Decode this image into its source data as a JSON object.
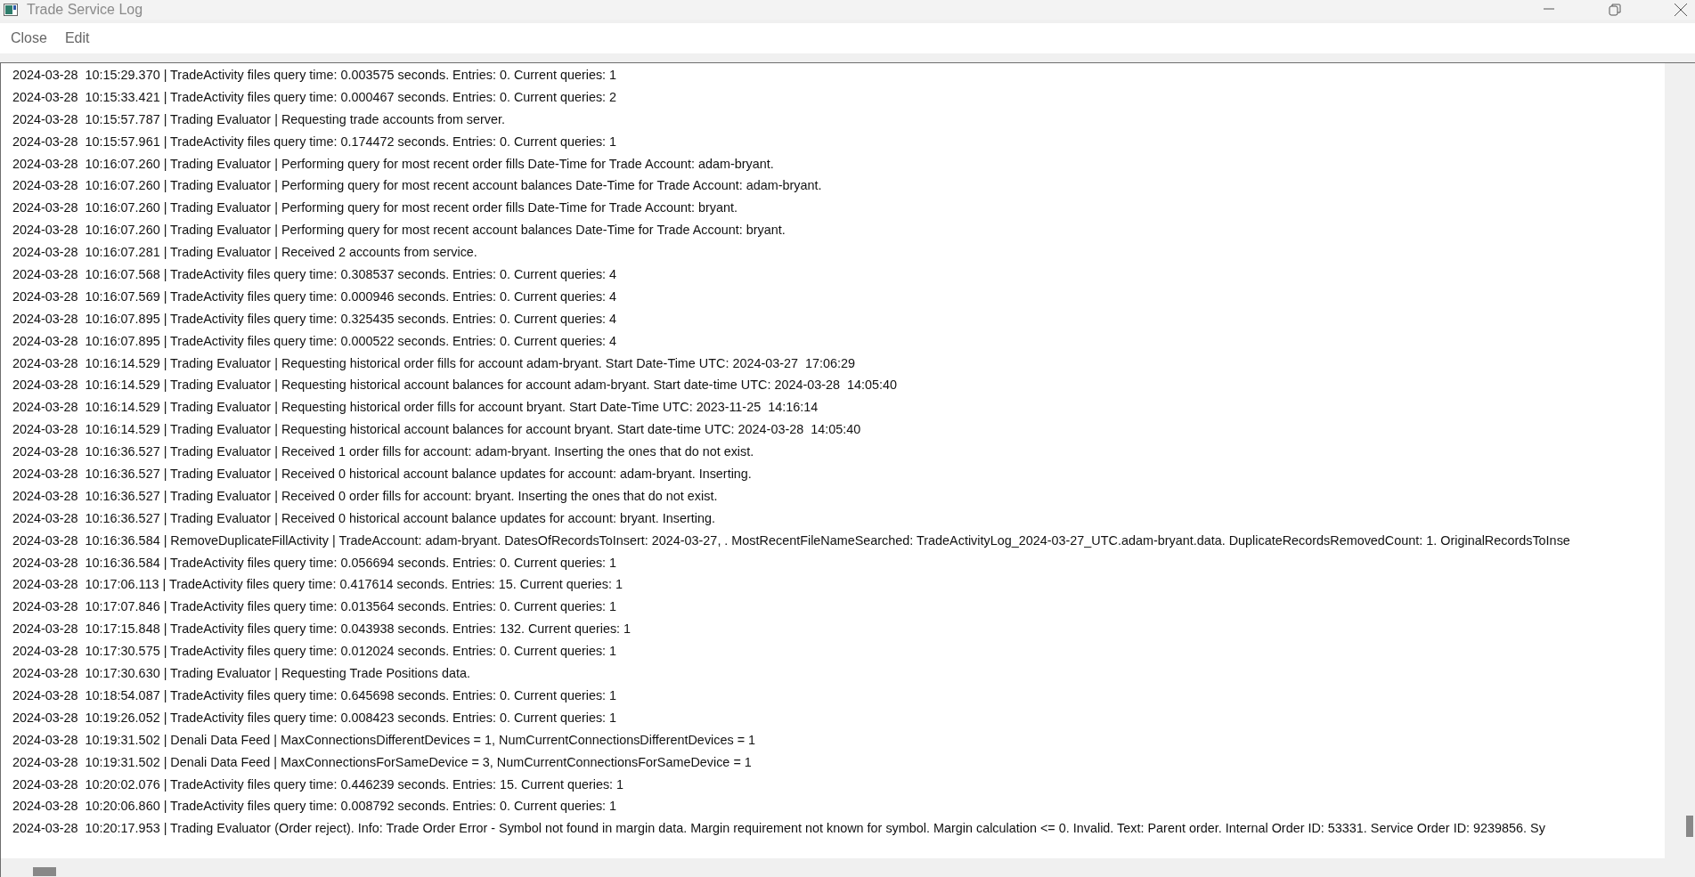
{
  "window": {
    "title": "Trade Service Log"
  },
  "menu": [
    "Close",
    "Edit"
  ],
  "log_lines": [
    "2024-03-28  10:15:29.370 | TradeActivity files query time: 0.003575 seconds. Entries: 0. Current queries: 1",
    "2024-03-28  10:15:33.421 | TradeActivity files query time: 0.000467 seconds. Entries: 0. Current queries: 2",
    "2024-03-28  10:15:57.787 | Trading Evaluator | Requesting trade accounts from server.",
    "2024-03-28  10:15:57.961 | TradeActivity files query time: 0.174472 seconds. Entries: 0. Current queries: 1",
    "2024-03-28  10:16:07.260 | Trading Evaluator | Performing query for most recent order fills Date-Time for Trade Account: adam-bryant.",
    "2024-03-28  10:16:07.260 | Trading Evaluator | Performing query for most recent account balances Date-Time for Trade Account: adam-bryant.",
    "2024-03-28  10:16:07.260 | Trading Evaluator | Performing query for most recent order fills Date-Time for Trade Account: bryant.",
    "2024-03-28  10:16:07.260 | Trading Evaluator | Performing query for most recent account balances Date-Time for Trade Account: bryant.",
    "2024-03-28  10:16:07.281 | Trading Evaluator | Received 2 accounts from service.",
    "2024-03-28  10:16:07.568 | TradeActivity files query time: 0.308537 seconds. Entries: 0. Current queries: 4",
    "2024-03-28  10:16:07.569 | TradeActivity files query time: 0.000946 seconds. Entries: 0. Current queries: 4",
    "2024-03-28  10:16:07.895 | TradeActivity files query time: 0.325435 seconds. Entries: 0. Current queries: 4",
    "2024-03-28  10:16:07.895 | TradeActivity files query time: 0.000522 seconds. Entries: 0. Current queries: 4",
    "2024-03-28  10:16:14.529 | Trading Evaluator | Requesting historical order fills for account adam-bryant. Start Date-Time UTC: 2024-03-27  17:06:29",
    "2024-03-28  10:16:14.529 | Trading Evaluator | Requesting historical account balances for account adam-bryant. Start date-time UTC: 2024-03-28  14:05:40",
    "2024-03-28  10:16:14.529 | Trading Evaluator | Requesting historical order fills for account bryant. Start Date-Time UTC: 2023-11-25  14:16:14",
    "2024-03-28  10:16:14.529 | Trading Evaluator | Requesting historical account balances for account bryant. Start date-time UTC: 2024-03-28  14:05:40",
    "2024-03-28  10:16:36.527 | Trading Evaluator | Received 1 order fills for account: adam-bryant. Inserting the ones that do not exist.",
    "2024-03-28  10:16:36.527 | Trading Evaluator | Received 0 historical account balance updates for account: adam-bryant. Inserting.",
    "2024-03-28  10:16:36.527 | Trading Evaluator | Received 0 order fills for account: bryant. Inserting the ones that do not exist.",
    "2024-03-28  10:16:36.527 | Trading Evaluator | Received 0 historical account balance updates for account: bryant. Inserting.",
    "2024-03-28  10:16:36.584 | RemoveDuplicateFillActivity | TradeAccount: adam-bryant. DatesOfRecordsToInsert: 2024-03-27, . MostRecentFileNameSearched: TradeActivityLog_2024-03-27_UTC.adam-bryant.data. DuplicateRecordsRemovedCount: 1. OriginalRecordsToInse",
    "2024-03-28  10:16:36.584 | TradeActivity files query time: 0.056694 seconds. Entries: 0. Current queries: 1",
    "2024-03-28  10:17:06.113 | TradeActivity files query time: 0.417614 seconds. Entries: 15. Current queries: 1",
    "2024-03-28  10:17:07.846 | TradeActivity files query time: 0.013564 seconds. Entries: 0. Current queries: 1",
    "2024-03-28  10:17:15.848 | TradeActivity files query time: 0.043938 seconds. Entries: 132. Current queries: 1",
    "2024-03-28  10:17:30.575 | TradeActivity files query time: 0.012024 seconds. Entries: 0. Current queries: 1",
    "2024-03-28  10:17:30.630 | Trading Evaluator | Requesting Trade Positions data.",
    "2024-03-28  10:18:54.087 | TradeActivity files query time: 0.645698 seconds. Entries: 0. Current queries: 1",
    "2024-03-28  10:19:26.052 | TradeActivity files query time: 0.008423 seconds. Entries: 0. Current queries: 1",
    "2024-03-28  10:19:31.502 | Denali Data Feed | MaxConnectionsDifferentDevices = 1, NumCurrentConnectionsDifferentDevices = 1",
    "2024-03-28  10:19:31.502 | Denali Data Feed | MaxConnectionsForSameDevice = 3, NumCurrentConnectionsForSameDevice = 1",
    "2024-03-28  10:20:02.076 | TradeActivity files query time: 0.446239 seconds. Entries: 15. Current queries: 1",
    "2024-03-28  10:20:06.860 | TradeActivity files query time: 0.008792 seconds. Entries: 0. Current queries: 1",
    "2024-03-28  10:20:17.953 | Trading Evaluator (Order reject). Info: Trade Order Error - Symbol not found in margin data. Margin requirement not known for symbol. Margin calculation <= 0. Invalid. Text: Parent order. Internal Order ID: 53331. Service Order ID: 9239856. Sy"
  ]
}
